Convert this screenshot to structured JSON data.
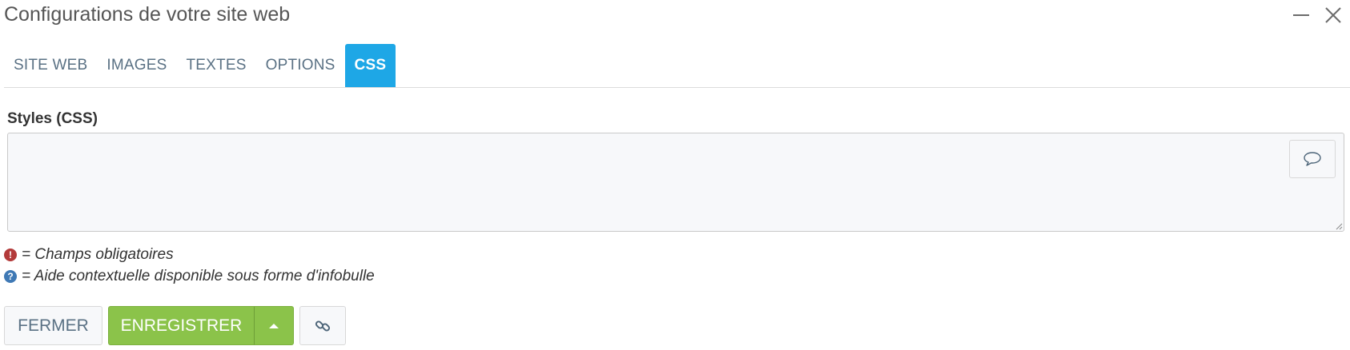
{
  "window": {
    "title": "Configurations de votre site web"
  },
  "tabs": [
    {
      "label": "SITE WEB",
      "active": false
    },
    {
      "label": "IMAGES",
      "active": false
    },
    {
      "label": "TEXTES",
      "active": false
    },
    {
      "label": "OPTIONS",
      "active": false
    },
    {
      "label": "CSS",
      "active": true
    }
  ],
  "css_field": {
    "label": "Styles (CSS)",
    "value": "",
    "comment_icon": "speech-bubble-icon"
  },
  "legend": {
    "required_symbol": "!",
    "required_text": "= Champs obligatoires",
    "help_symbol": "?",
    "help_text": "= Aide contextuelle disponible sous forme d'infobulle"
  },
  "actions": {
    "close_label": "FERMER",
    "save_label": "ENREGISTRER",
    "save_menu_icon": "caret-up-icon",
    "link_icon": "link-icon"
  },
  "colors": {
    "active_tab": "#1ea7e6",
    "save_button": "#8bc34a",
    "required_badge": "#b33a3a",
    "help_badge": "#3f79b5"
  }
}
